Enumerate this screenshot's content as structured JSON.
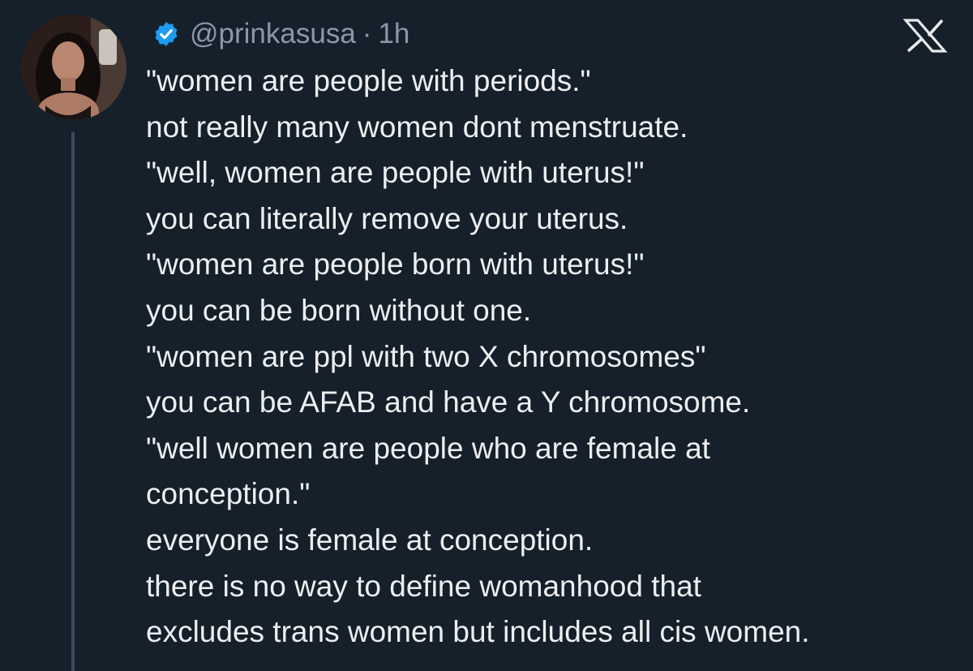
{
  "tweet": {
    "handle": "@prinkasusa",
    "separator": "·",
    "time": "1h",
    "brand_icon": "x-logo-icon",
    "verified_icon": "verified-badge-icon",
    "colors": {
      "background": "#15202b",
      "text": "#e7e9ea",
      "muted": "#8b98a5",
      "verified": "#1d9bf0",
      "thread_line": "#3e4b59"
    },
    "lines": [
      "\"women are people with periods.\"",
      "not really many women dont menstruate.",
      "\"well, women are people with uterus!\"",
      "you can literally remove your uterus.",
      "\"women are people born with uterus!\"",
      "you can be born without one.",
      "\"women are ppl with two X chromosomes\"",
      "you can be AFAB and have a Y chromosome.",
      "\"well women are people who are female at",
      "conception.\"",
      "everyone is female at conception.",
      "there is no way to define womanhood that",
      "excludes trans women but includes all cis women."
    ]
  }
}
